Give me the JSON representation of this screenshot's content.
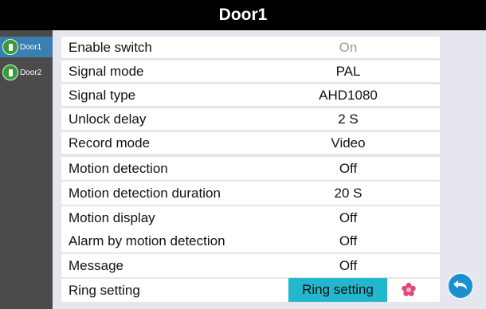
{
  "title": "Door1",
  "sidebar": {
    "items": [
      {
        "label": "Door1",
        "active": true
      },
      {
        "label": "Door2",
        "active": false
      }
    ]
  },
  "settings": [
    {
      "label": "Enable switch",
      "value": "On",
      "disabled": true
    },
    {
      "label": "Signal mode",
      "value": "PAL"
    },
    {
      "label": "Signal type",
      "value": "AHD1080"
    },
    {
      "label": "Unlock delay",
      "value": "2 S"
    },
    {
      "label": "Record mode",
      "value": "Video"
    },
    {
      "label": "Motion detection",
      "value": "Off"
    },
    {
      "label": "Motion detection duration",
      "value": "20 S"
    },
    {
      "label": "Motion display",
      "value": "Off"
    },
    {
      "label": "Alarm by motion detection",
      "value": "Off"
    },
    {
      "label": "Message",
      "value": "Off"
    },
    {
      "label": "Ring setting"
    }
  ],
  "ring_button_label": "Ring setting",
  "icons": {
    "door": "door-icon",
    "flower": "flower-icon",
    "back": "back-arrow-icon"
  },
  "colors": {
    "titlebar": "#000000",
    "sidebar": "#4b4b4b",
    "active_tab": "#3a7fb0",
    "panel": "#e6e6ee",
    "ring_button": "#22b7cc",
    "back_button": "#1b8fd0",
    "flower": "#e0457b"
  }
}
